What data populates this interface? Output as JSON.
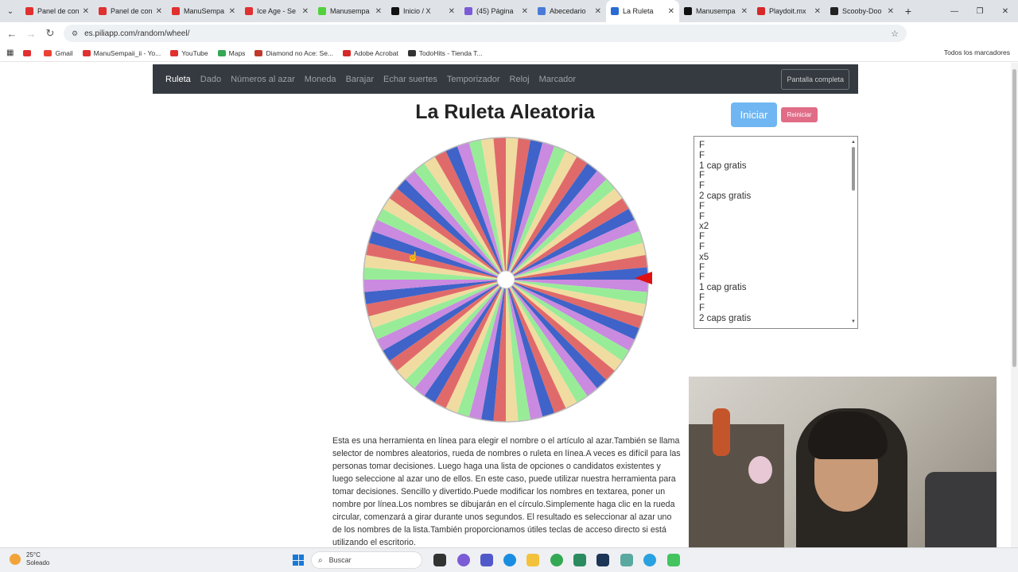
{
  "browser": {
    "tabs": [
      {
        "label": "Panel de con",
        "color": "#e03030"
      },
      {
        "label": "Panel de con",
        "color": "#e03030"
      },
      {
        "label": "ManuSempa",
        "color": "#e03030"
      },
      {
        "label": "Ice Age - Se",
        "color": "#e03030"
      },
      {
        "label": "Manusempa",
        "color": "#53d13c"
      },
      {
        "label": "Inicio / X",
        "color": "#111111"
      },
      {
        "label": "(45) Página",
        "color": "#7c5cd6"
      },
      {
        "label": "Abecedario",
        "color": "#4a7bd8"
      },
      {
        "label": "La Ruleta",
        "color": "#2b6cd4",
        "active": true
      },
      {
        "label": "Manusempa",
        "color": "#111111"
      },
      {
        "label": "Playdoit.mx",
        "color": "#d62828"
      },
      {
        "label": "Scooby-Doo",
        "color": "#222222"
      }
    ],
    "url": "es.piliapp.com/random/wheel/",
    "bookmarks": [
      "",
      "Gmail",
      "ManuSempaii_ii - Yo...",
      "YouTube",
      "Maps",
      "Diamond no Ace: Se...",
      "Adobe Acrobat",
      "TodoHits - Tienda T..."
    ],
    "bookmarks_right": "Todos los marcadores"
  },
  "site": {
    "nav": [
      "Ruleta",
      "Dado",
      "Números al azar",
      "Moneda",
      "Barajar",
      "Echar suertes",
      "Temporizador",
      "Reloj",
      "Marcador"
    ],
    "fullscreen": "Pantalla completa",
    "title": "La Ruleta Aleatoria",
    "start": "Iniciar",
    "reset": "Reiniciar",
    "entries": [
      "F",
      "F",
      "1 cap gratis",
      "F",
      "F",
      "2 caps gratis",
      "F",
      "F",
      "x2",
      "F",
      "F",
      "x5",
      "F",
      "F",
      "1 cap gratis",
      "F",
      "F",
      "2 caps gratis"
    ],
    "description": "Esta es una herramienta en línea para elegir el nombre o el artículo al azar.También se llama selector de nombres aleatorios, rueda de nombres o ruleta en línea.A veces es difícil para las personas tomar decisiones. Luego haga una lista de opciones o candidatos existentes y luego seleccione al azar uno de ellos. En este caso, puede utilizar nuestra herramienta para tomar decisiones. Sencillo y divertido.Puede modificar los nombres en textarea, poner un nombre por línea.Los nombres se dibujarán en el círculo.Simplemente haga clic en la rueda circular, comenzará a girar durante unos segundos. El resultado es seleccionar al azar uno de los nombres de la lista.También proporcionamos útiles teclas de acceso directo si está utilizando el escritorio."
  },
  "wheel": {
    "colors": [
      "#f0dca0",
      "#e06a6a",
      "#3f63c8",
      "#c98ae0",
      "#98ec98"
    ]
  },
  "taskbar": {
    "temp": "25°C",
    "weather": "Soleado",
    "search": "Buscar"
  }
}
